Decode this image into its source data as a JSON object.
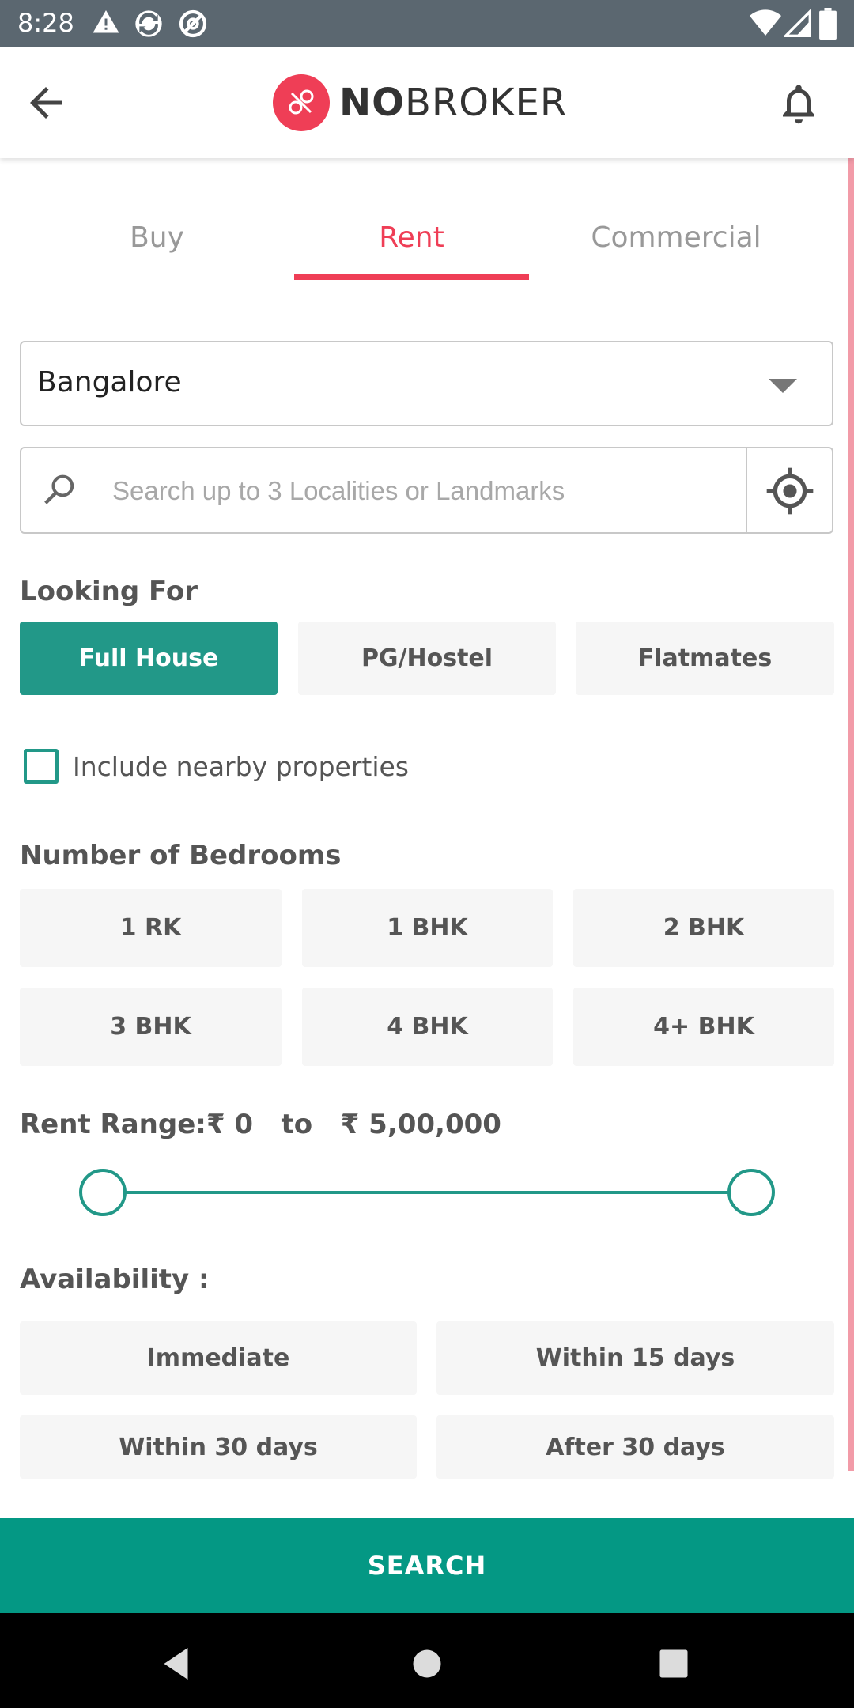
{
  "status_bar": {
    "time": "8:28",
    "left_icons": [
      "warning-icon",
      "sync-icon",
      "no-location-icon"
    ],
    "right_icons": [
      "wifi-icon",
      "signal-icon",
      "battery-icon"
    ]
  },
  "app_bar": {
    "back_icon": "arrow-left-icon",
    "logo_bold": "NO",
    "logo_regular": "BROKER",
    "notification_icon": "bell-icon"
  },
  "tabs": [
    {
      "label": "Buy",
      "active": false
    },
    {
      "label": "Rent",
      "active": true
    },
    {
      "label": "Commercial",
      "active": false
    }
  ],
  "city": {
    "value": "Bangalore"
  },
  "search": {
    "placeholder": "Search up to 3 Localities or Landmarks",
    "value": ""
  },
  "looking_for": {
    "label": "Looking For",
    "options": [
      {
        "label": "Full House",
        "selected": true
      },
      {
        "label": "PG/Hostel",
        "selected": false
      },
      {
        "label": "Flatmates",
        "selected": false
      }
    ]
  },
  "nearby": {
    "label": "Include nearby properties",
    "checked": false
  },
  "bedrooms": {
    "label": "Number of Bedrooms",
    "options": [
      "1 RK",
      "1 BHK",
      "2 BHK",
      "3 BHK",
      "4 BHK",
      "4+ BHK"
    ]
  },
  "rent_range": {
    "label": "Rent Range:",
    "min": "₹ 0",
    "to": "to",
    "max": "₹ 5,00,000",
    "min_fraction": 0,
    "max_fraction": 1
  },
  "availability": {
    "label": "Availability :",
    "options": [
      "Immediate",
      "Within 15 days",
      "Within 30 days",
      "After 30 days"
    ]
  },
  "search_button": {
    "label": "SEARCH"
  },
  "colors": {
    "accent": "#ef3e56",
    "primary": "#229888",
    "search_button": "#049884"
  }
}
